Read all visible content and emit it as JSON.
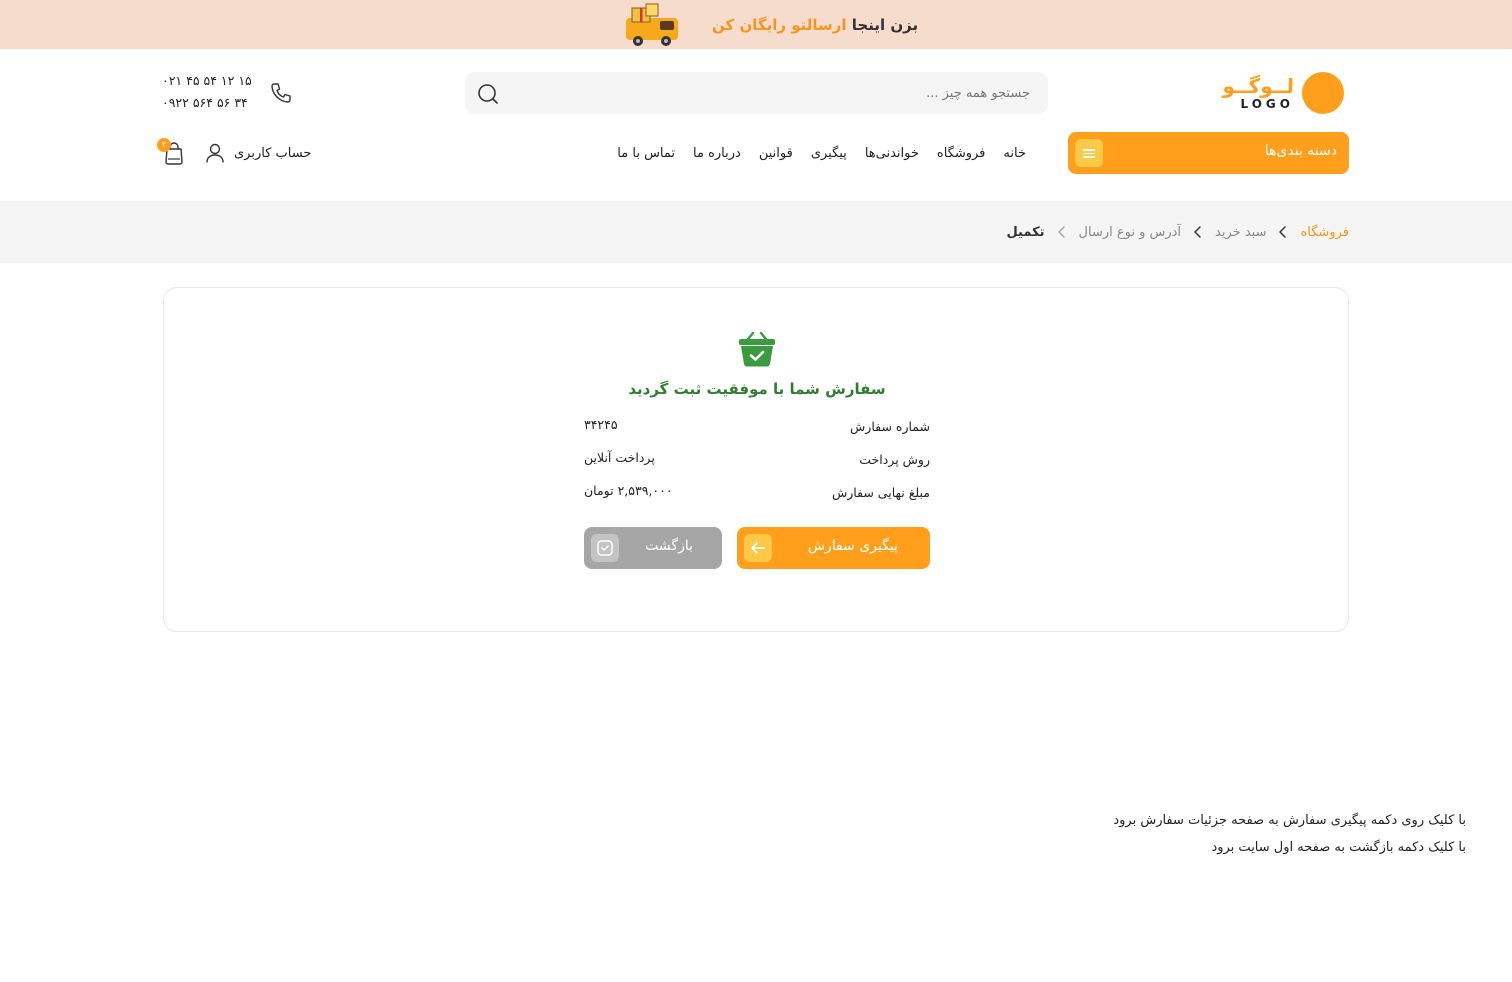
{
  "promo": {
    "prefix": "بزن اینجا ",
    "highlight": "ارسالتو رایگان کن",
    "image": "delivery-truck-with-gift"
  },
  "header": {
    "logo_word": "لــوگــو",
    "logo_latin": "LOGO",
    "search_placeholder": "جستجو همه چیز ...",
    "search_icon": "search-icon",
    "phone_icon": "phone-icon",
    "phone_1": "۰۲۱ ۴۵ ۵۴ ۱۲ ۱۵",
    "phone_2": "۰۹۲۲ ۵۶۴ ۵۶ ۳۴"
  },
  "categories": {
    "label": "دسته بندی‌ها",
    "icon": "menu-icon"
  },
  "nav": {
    "items": [
      "خانه",
      "فروشگاه",
      "خواندنی‌ها",
      "پیگیری",
      "قوانین",
      "درباره ما",
      "تماس با ما"
    ]
  },
  "account": {
    "label": "حساب کاربری",
    "icon": "user-icon"
  },
  "cart": {
    "icon": "bag-icon",
    "count": "۲"
  },
  "breadcrumb": {
    "items": [
      "فروشگاه",
      "سبد خرید",
      "آدرس و نوع ارسال",
      "تکمیل"
    ]
  },
  "order": {
    "icon": "basket-check-icon",
    "title": "سفارش شما با موفقیت ثبت گردید",
    "rows": [
      {
        "label": "شماره سفارش",
        "value": "۳۴۲۴۵"
      },
      {
        "label": "روش پرداخت",
        "value": "پرداخت آنلاین"
      },
      {
        "label": "مبلغ نهایی سفارش",
        "value": "۲,۵۳۹,۰۰۰ تومان"
      }
    ],
    "track_button": "پیگیری سفارش",
    "back_button": "بازگشت"
  },
  "notes": {
    "line_1": "با کلیک روی دکمه پیگیری سفارش به صفحه جزئیات سفارش برود",
    "line_2": "با کلیک دکمه بازگشت به صفحه اول سایت برود"
  },
  "colors": {
    "accent": "#ff9f1c",
    "accent_light": "#ffc948",
    "promo_bg": "#f5dccd",
    "success": "#2e7d32",
    "success_icon": "#3a9b3f",
    "muted_button": "#a6a6a6"
  }
}
